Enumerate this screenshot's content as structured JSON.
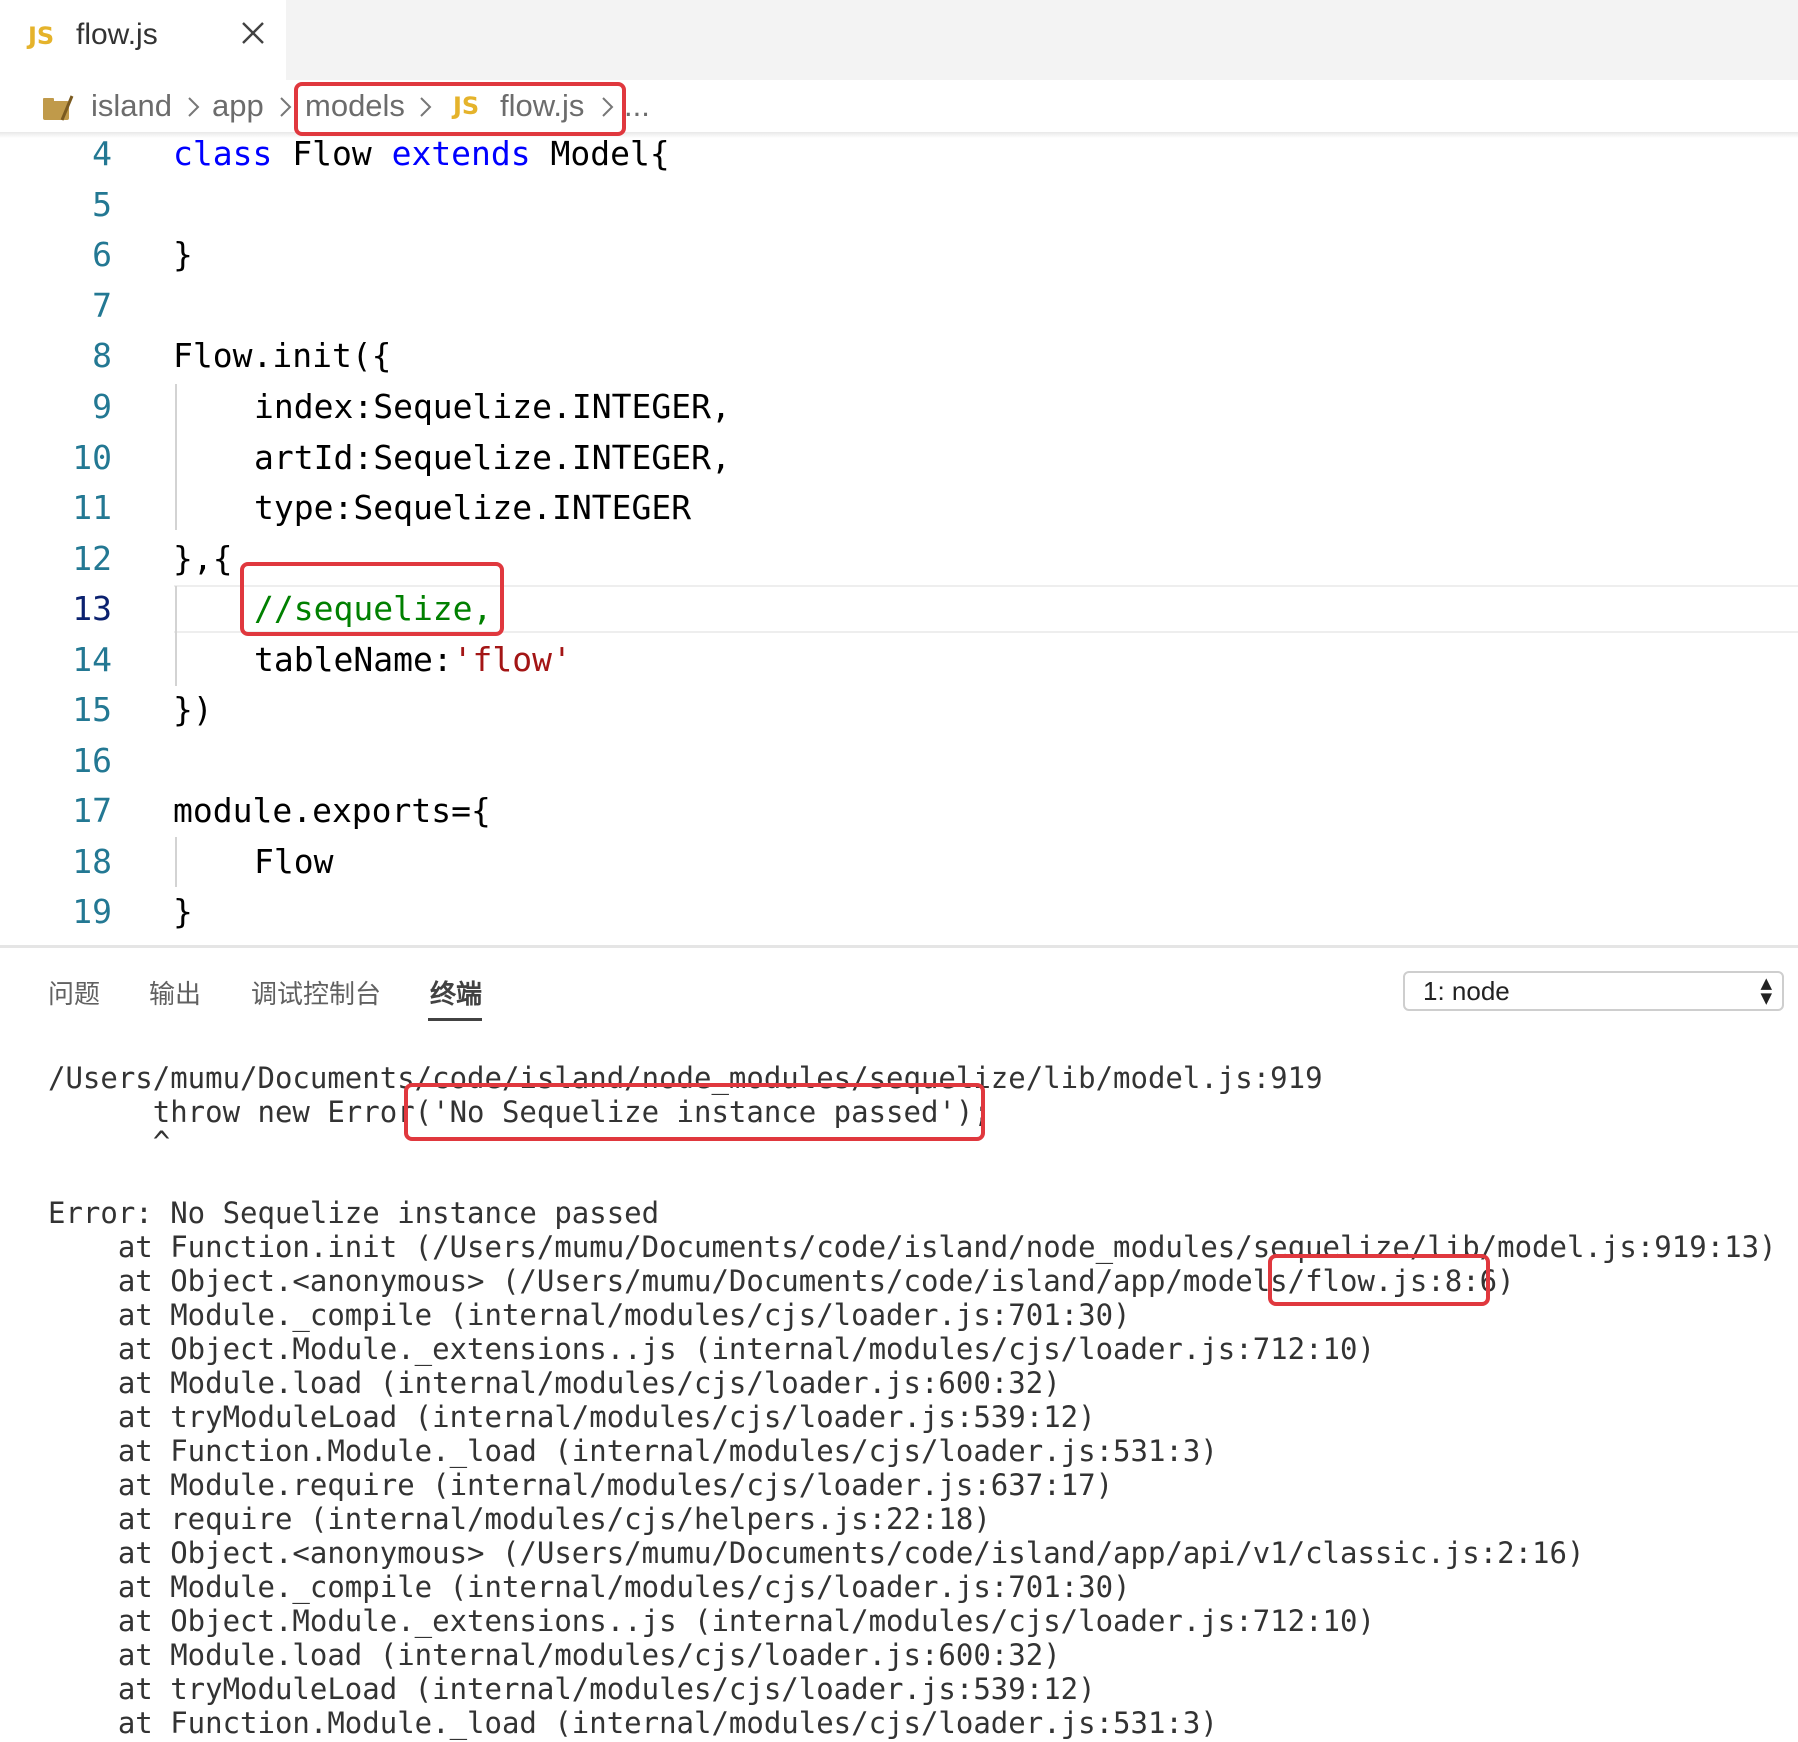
{
  "tab": {
    "icon": "JS",
    "filename": "flow.js"
  },
  "breadcrumb": {
    "items": [
      "island",
      "app",
      "models",
      "flow.js",
      "..."
    ],
    "file_icon": "JS"
  },
  "editor": {
    "lines": [
      {
        "n": "4",
        "parts": [
          [
            "kw",
            "class"
          ],
          [
            "",
            "Flow"
          ],
          [
            "kw",
            "extends"
          ],
          [
            "",
            "Model{"
          ]
        ]
      },
      {
        "n": "5",
        "parts": []
      },
      {
        "n": "6",
        "parts": [
          [
            "",
            "}"
          ]
        ]
      },
      {
        "n": "7",
        "parts": []
      },
      {
        "n": "8",
        "parts": [
          [
            "",
            "Flow.init({"
          ]
        ]
      },
      {
        "n": "9",
        "parts": [
          [
            "",
            "index:Sequelize.INTEGER,"
          ]
        ]
      },
      {
        "n": "10",
        "parts": [
          [
            "",
            "artId:Sequelize.INTEGER,"
          ]
        ]
      },
      {
        "n": "11",
        "parts": [
          [
            "",
            "type:Sequelize.INTEGER"
          ]
        ]
      },
      {
        "n": "12",
        "parts": [
          [
            "",
            "},{"
          ]
        ]
      },
      {
        "n": "13",
        "parts": [
          [
            "cm",
            "//sequelize,"
          ]
        ]
      },
      {
        "n": "14",
        "parts": [
          [
            "",
            "tableName:"
          ],
          [
            "str",
            "'flow'"
          ]
        ]
      },
      {
        "n": "15",
        "parts": [
          [
            "",
            "})"
          ]
        ]
      },
      {
        "n": "16",
        "parts": []
      },
      {
        "n": "17",
        "parts": [
          [
            "",
            "module.exports={"
          ]
        ]
      },
      {
        "n": "18",
        "parts": [
          [
            "",
            "Flow"
          ]
        ]
      },
      {
        "n": "19",
        "parts": [
          [
            "",
            "}"
          ]
        ]
      }
    ]
  },
  "panel": {
    "tabs": [
      "问题",
      "输出",
      "调试控制台",
      "终端"
    ],
    "active_tab": "终端",
    "terminal_select": "1: node"
  },
  "terminal": {
    "lines": [
      "/Users/mumu/Documents/code/island/node_modules/sequelize/lib/model.js:919",
      "      throw new Error('No Sequelize instance passed');",
      "      ^",
      "",
      "Error: No Sequelize instance passed",
      "    at Function.init (/Users/mumu/Documents/code/island/node_modules/sequelize/lib/model.js:919:13)",
      "    at Object.<anonymous> (/Users/mumu/Documents/code/island/app/models/flow.js:8:6)",
      "    at Module._compile (internal/modules/cjs/loader.js:701:30)",
      "    at Object.Module._extensions..js (internal/modules/cjs/loader.js:712:10)",
      "    at Module.load (internal/modules/cjs/loader.js:600:32)",
      "    at tryModuleLoad (internal/modules/cjs/loader.js:539:12)",
      "    at Function.Module._load (internal/modules/cjs/loader.js:531:3)",
      "    at Module.require (internal/modules/cjs/loader.js:637:17)",
      "    at require (internal/modules/cjs/helpers.js:22:18)",
      "    at Object.<anonymous> (/Users/mumu/Documents/code/island/app/api/v1/classic.js:2:16)",
      "    at Module._compile (internal/modules/cjs/loader.js:701:30)",
      "    at Object.Module._extensions..js (internal/modules/cjs/loader.js:712:10)",
      "    at Module.load (internal/modules/cjs/loader.js:600:32)",
      "    at tryModuleLoad (internal/modules/cjs/loader.js:539:12)",
      "    at Function.Module._load (internal/modules/cjs/loader.js:531:3)"
    ]
  },
  "colors": {
    "highlight_box": "#e0383e",
    "keyword": "#0000ff",
    "comment": "#008000",
    "string": "#a31515",
    "line_number": "#237893",
    "js_icon": "#e5b32b"
  }
}
